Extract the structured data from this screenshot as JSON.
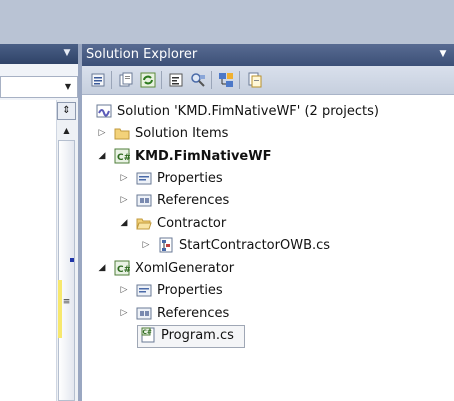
{
  "solution_explorer": {
    "title": "Solution Explorer",
    "toolbar": [
      "properties",
      "show-all-files",
      "refresh",
      "view-code",
      "view-designer",
      "class-diagram",
      "nest-related-files"
    ],
    "tree": [
      {
        "label": "Solution 'KMD.FimNativeWF' (2 projects)",
        "icon": "solution-icon",
        "expander": "none",
        "bold": false
      },
      {
        "label": "Solution Items",
        "icon": "folder-icon",
        "expander": "collapsed",
        "bold": false
      },
      {
        "label": "KMD.FimNativeWF",
        "icon": "csharp-project-icon",
        "expander": "expanded",
        "bold": true
      },
      {
        "label": "Properties",
        "icon": "properties-icon",
        "expander": "collapsed",
        "bold": false
      },
      {
        "label": "References",
        "icon": "references-icon",
        "expander": "collapsed",
        "bold": false
      },
      {
        "label": "Contractor",
        "icon": "open-folder-icon",
        "expander": "expanded",
        "bold": false
      },
      {
        "label": "StartContractorOWB.cs",
        "icon": "workflow-file-icon",
        "expander": "collapsed",
        "bold": false
      },
      {
        "label": "XomlGenerator",
        "icon": "csharp-project-icon",
        "expander": "expanded",
        "bold": false
      },
      {
        "label": "Properties",
        "icon": "properties-icon",
        "expander": "collapsed",
        "bold": false
      },
      {
        "label": "References",
        "icon": "references-icon",
        "expander": "collapsed",
        "bold": false
      },
      {
        "label": "Program.cs",
        "icon": "csharp-file-icon",
        "expander": "none",
        "bold": false,
        "selected": true
      }
    ]
  },
  "colors": {
    "title_bar": "#3c5077",
    "toolbar": "#d0d8e6",
    "tree_bg": "#ffffff"
  }
}
